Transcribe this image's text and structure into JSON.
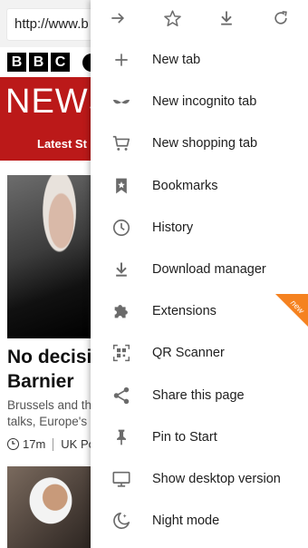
{
  "page": {
    "url": "http://www.b",
    "bbc_letters": [
      "B",
      "B",
      "C"
    ],
    "news_word": "NEWS",
    "subnav": "Latest St",
    "headline_lines": [
      "No decisiv",
      "Barnier"
    ],
    "summary_lines": [
      "Brussels and th",
      "talks, Europe's"
    ],
    "meta_time": "17m",
    "meta_section": "UK Po"
  },
  "menu": {
    "toolbar": [
      {
        "name": "forward-icon"
      },
      {
        "name": "star-icon"
      },
      {
        "name": "download-icon"
      },
      {
        "name": "refresh-icon"
      }
    ],
    "items": [
      {
        "label": "New tab",
        "icon": "plus-icon"
      },
      {
        "label": "New incognito tab",
        "icon": "incognito-mask-icon"
      },
      {
        "label": "New shopping tab",
        "icon": "shopping-cart-icon"
      },
      {
        "label": "Bookmarks",
        "icon": "bookmark-star-icon"
      },
      {
        "label": "History",
        "icon": "clock-icon"
      },
      {
        "label": "Download manager",
        "icon": "download-icon"
      },
      {
        "label": "Extensions",
        "icon": "puzzle-icon"
      },
      {
        "label": "QR Scanner",
        "icon": "qr-icon"
      },
      {
        "label": "Share this page",
        "icon": "share-icon"
      },
      {
        "label": "Pin to Start",
        "icon": "pin-icon"
      },
      {
        "label": "Show desktop version",
        "icon": "monitor-icon"
      },
      {
        "label": "Night mode",
        "icon": "moon-icon"
      }
    ],
    "new_badge": "new",
    "icon_color": "#6b6b6b",
    "badge_color": "#f58220"
  }
}
